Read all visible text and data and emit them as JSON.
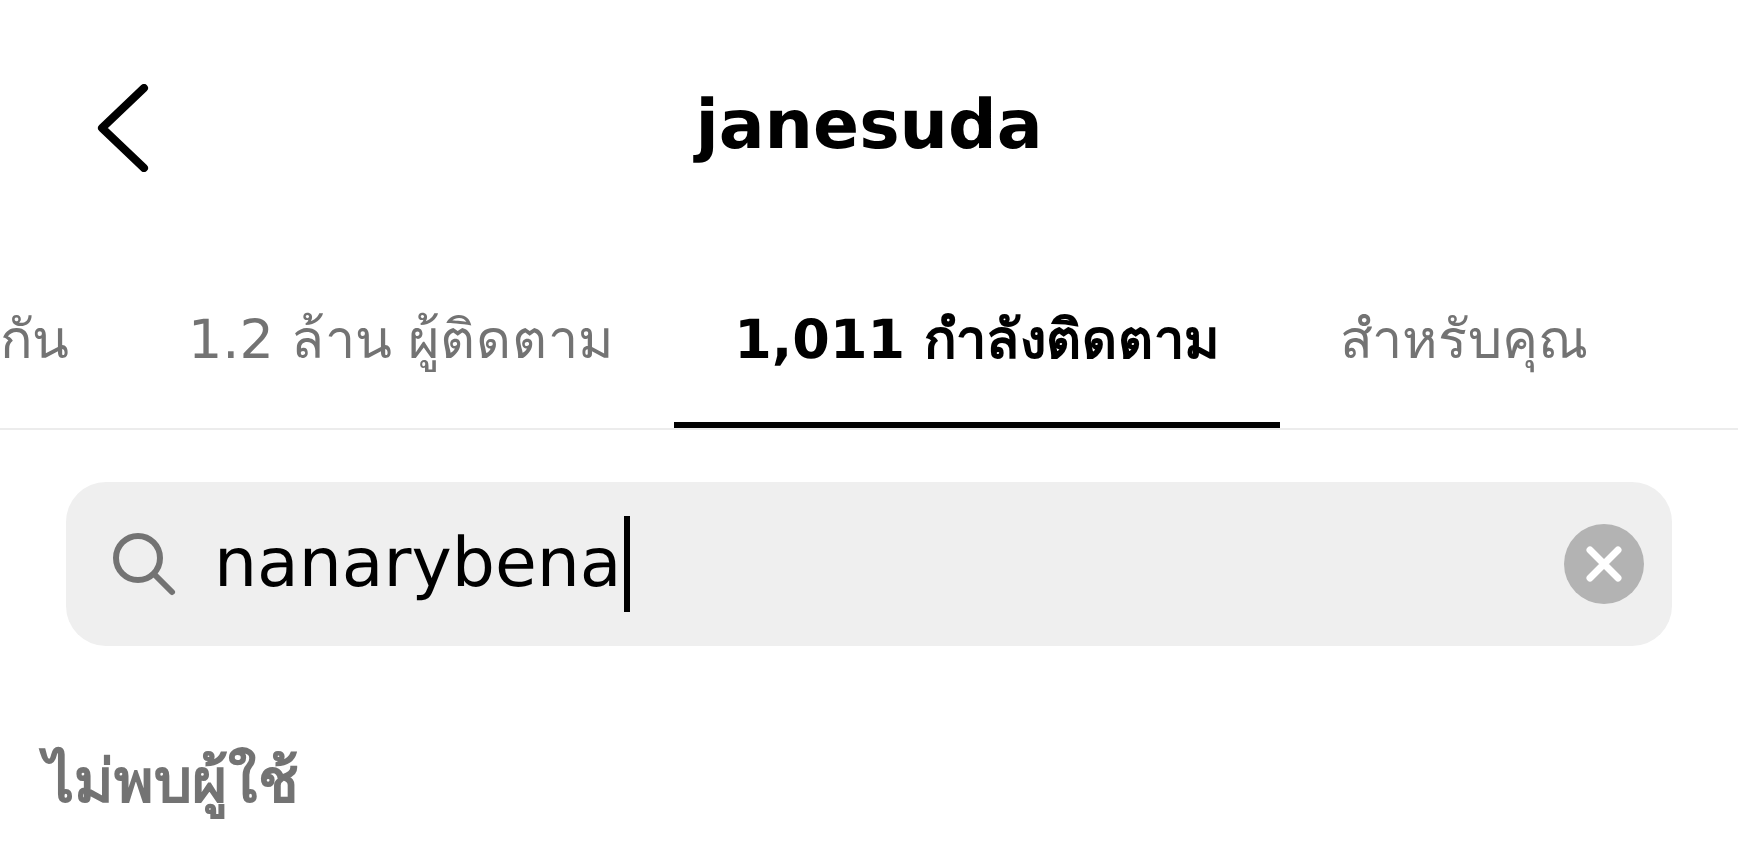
{
  "header": {
    "title": "janesuda"
  },
  "tabs": [
    {
      "label": "กัน",
      "selected": false
    },
    {
      "label": "1.2 ล้าน ผู้ติดตาม",
      "selected": false
    },
    {
      "label": "1,011 กำลังติดตาม",
      "selected": true
    },
    {
      "label": "สำหรับคุณ",
      "selected": false
    }
  ],
  "search": {
    "value": "nanarybena"
  },
  "empty_message": "ไม่พบผู้ใช้"
}
